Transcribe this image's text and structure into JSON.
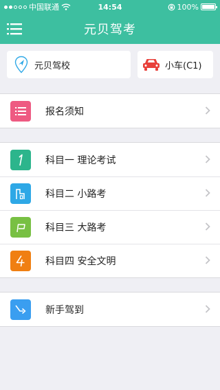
{
  "status": {
    "carrier": "中国联通",
    "time": "14:54",
    "battery": "100%",
    "battery_level": 1.0
  },
  "nav": {
    "title": "元贝驾考"
  },
  "selectors": {
    "school": "元贝驾校",
    "car": "小车(C1)"
  },
  "groups": {
    "signup": {
      "label": "报名须知"
    },
    "subjects": [
      {
        "label": "科目一 理论考试",
        "color": "#2cb58c"
      },
      {
        "label": "科目二 小路考",
        "color": "#2ea8e6"
      },
      {
        "label": "科目三 大路考",
        "color": "#78c043"
      },
      {
        "label": "科目四 安全文明",
        "color": "#f07f12"
      }
    ],
    "newbie": {
      "label": "新手驾到",
      "color": "#3a9ef0"
    }
  },
  "colors": {
    "brand": "#3dbfa0",
    "signup_icon": "#ee5a82",
    "car_icon": "#e8403a"
  },
  "icons": {
    "menu": "list-menu-icon",
    "school": "location-pin-icon",
    "car": "car-icon",
    "signup": "list-icon",
    "subject1": "number-one-icon",
    "subject2": "small-road-icon",
    "subject3": "road-sign-icon",
    "subject4": "number-four-icon",
    "newbie": "arrow-turn-icon"
  }
}
